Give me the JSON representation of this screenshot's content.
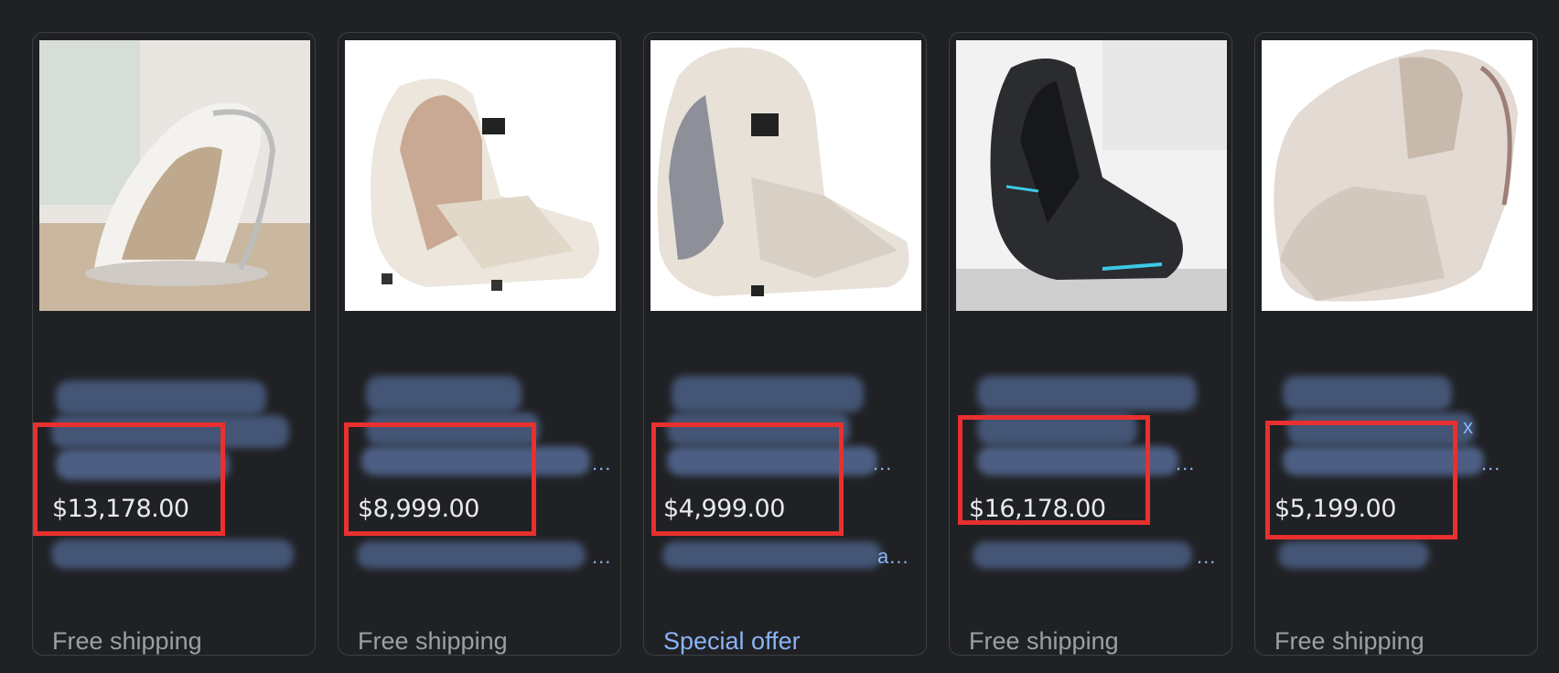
{
  "products": [
    {
      "price": "$13,178.00",
      "shipping": "Free shipping",
      "image_icon": "massage-chair-white-image"
    },
    {
      "price": "$8,999.00",
      "shipping": "Free shipping",
      "image_icon": "massage-chair-cream-image"
    },
    {
      "price": "$4,999.00",
      "shipping": "Special offer",
      "image_icon": "massage-chair-gray-image"
    },
    {
      "price": "$16,178.00",
      "shipping": "Free shipping",
      "image_icon": "massage-chair-black-image"
    },
    {
      "price": "$5,199.00",
      "shipping": "Free shipping",
      "image_icon": "massage-chair-beige-image"
    }
  ],
  "colors": {
    "highlight_box": "#e8302f",
    "link": "#8ab4f8",
    "background": "#202124"
  }
}
